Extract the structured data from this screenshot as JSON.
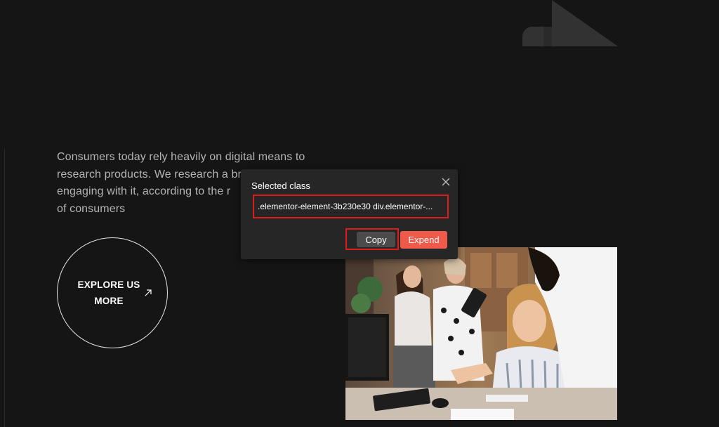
{
  "content": {
    "paragraph_lines": [
      "Consumers today rely heavily on digital means to",
      "research products. We research a br",
      "engaging with it, according to the r",
      "of consumers"
    ],
    "explore_label": "EXPLORE US MORE",
    "explore_icon": "arrow-up-right-icon"
  },
  "popup": {
    "title": "Selected class",
    "class_value": ".elementor-element-3b230e30 div.elementor-...",
    "copy_label": "Copy",
    "expend_label": "Expend",
    "close_icon": "close-icon"
  },
  "colors": {
    "background": "#151515",
    "text_muted": "#b4b4b4",
    "popup_bg": "#262626",
    "highlight_red": "#dd1c1c",
    "accent": "#ef5a4a",
    "copy_button": "#4b4b4b"
  }
}
